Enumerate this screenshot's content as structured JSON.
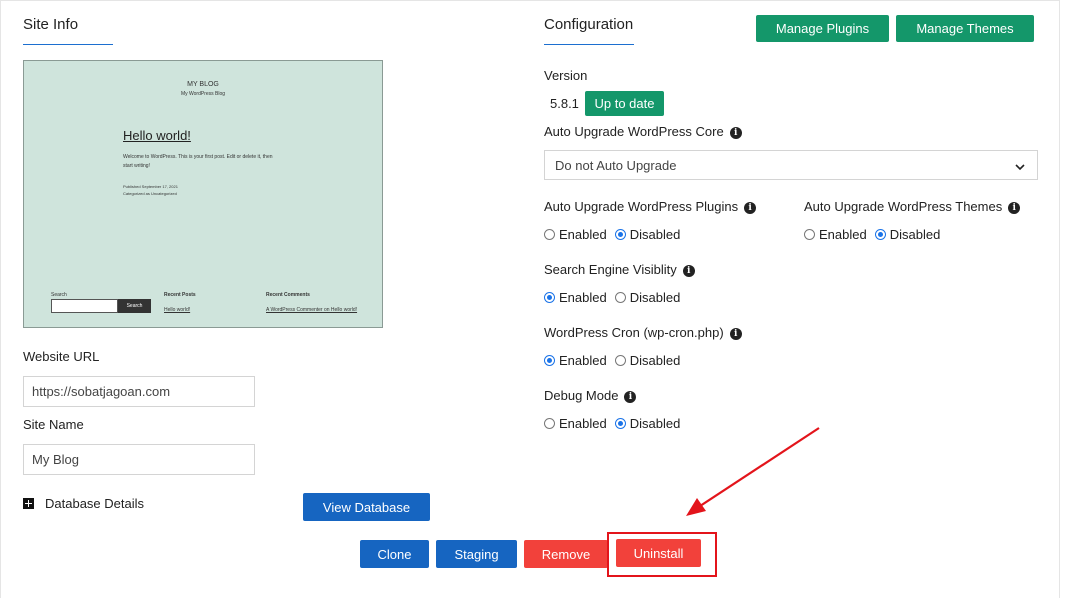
{
  "site_info": {
    "title": "Site Info",
    "preview": {
      "blog_title": "MY BLOG",
      "blog_tagline": "My WordPress Blog",
      "post_title": "Hello world!",
      "post_body_line1": "Welcome to WordPress. This is your first post. Edit or delete it, then",
      "post_body_line2": "start writing!",
      "post_meta_line1": "Published September 17, 2021",
      "post_meta_line2": "Categorized as Uncategorized",
      "search_label": "Search",
      "search_button": "Search",
      "recent_posts_title": "Recent Posts",
      "recent_posts_item": "Hello world!",
      "recent_comments_title": "Recent Comments",
      "recent_comments_item": "A WordPress Commenter on Hello world!"
    },
    "website_url_label": "Website URL",
    "website_url_value": "https://sobatjagoan.com",
    "site_name_label": "Site Name",
    "site_name_value": "My Blog",
    "database_details_label": "Database Details",
    "view_database_button": "View Database"
  },
  "configuration": {
    "title": "Configuration",
    "manage_plugins_button": "Manage Plugins",
    "manage_themes_button": "Manage Themes",
    "version_label": "Version",
    "version_value": "5.8.1",
    "version_status": "Up to date",
    "auto_upgrade_core_label": "Auto Upgrade WordPress Core",
    "auto_upgrade_core_value": "Do not Auto Upgrade",
    "auto_upgrade_plugins_label": "Auto Upgrade WordPress Plugins",
    "auto_upgrade_themes_label": "Auto Upgrade WordPress Themes",
    "search_engine_label": "Search Engine Visiblity",
    "cron_label": "WordPress Cron (wp-cron.php)",
    "debug_label": "Debug Mode",
    "enabled_text": "Enabled",
    "disabled_text": "Disabled"
  },
  "actions": {
    "clone": "Clone",
    "staging": "Staging",
    "remove": "Remove",
    "uninstall": "Uninstall"
  },
  "colors": {
    "green": "#14976a",
    "blue": "#1665c1",
    "red": "#f2413b",
    "highlight": "#e3141b"
  }
}
